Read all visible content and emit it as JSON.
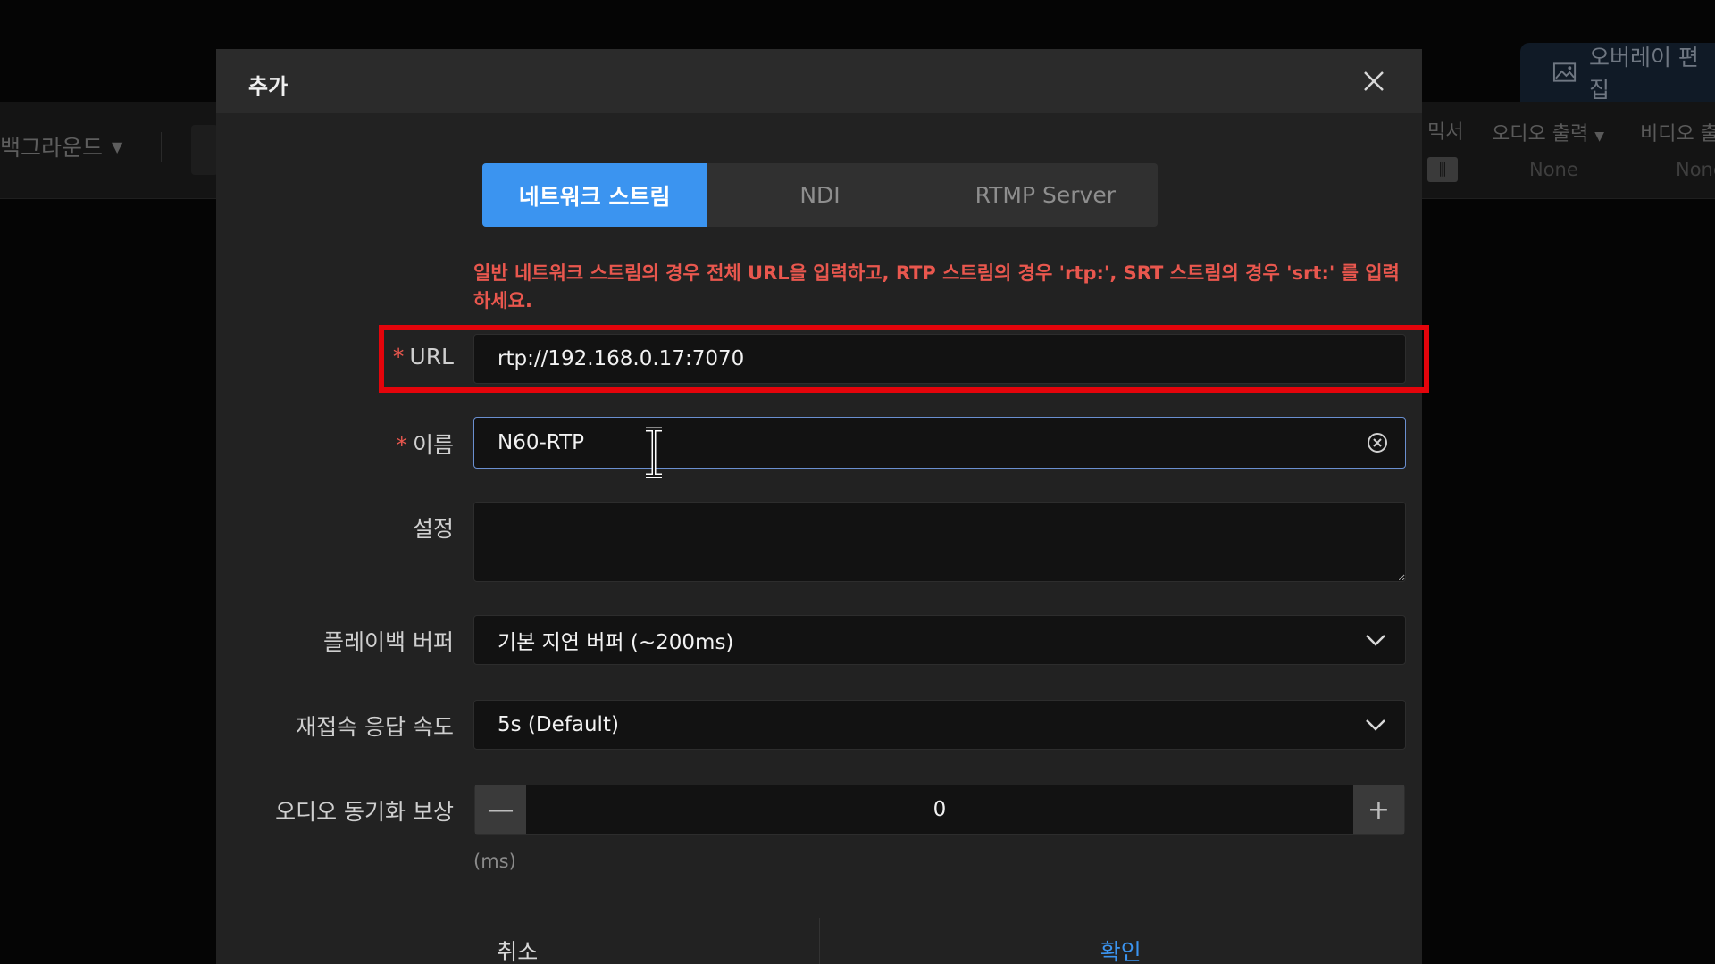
{
  "background": {
    "left_dropdown": "백그라운드",
    "overlay_tab": "오버레이 편집",
    "columns": {
      "mixer": "믹서",
      "audio_output": "오디오 출력",
      "video_output": "비디오 출"
    },
    "audio_output_value": "None",
    "video_output_value": "None"
  },
  "dialog": {
    "title": "추가",
    "tabs": [
      {
        "label": "네트워크 스트림",
        "active": true
      },
      {
        "label": "NDI",
        "active": false
      },
      {
        "label": "RTMP Server",
        "active": false
      }
    ],
    "hint": "일반 네트워크 스트림의 경우 전체 URL을 입력하고, RTP 스트림의 경우 'rtp:', SRT 스트림의 경우 'srt:' 를 입력하세요.",
    "url": {
      "label": "URL",
      "required_mark": "*",
      "value": "rtp://192.168.0.17:7070"
    },
    "name": {
      "label": "이름",
      "required_mark": "*",
      "value": "N60-RTP"
    },
    "settings": {
      "label": "설정",
      "value": ""
    },
    "playback_buffer": {
      "label": "플레이백 버퍼",
      "value": "기본 지연 버퍼 (~200ms)"
    },
    "reconnect_speed": {
      "label": "재접속 응답 속도",
      "value": "5s (Default)"
    },
    "audio_sync": {
      "label": "오디오 동기화 보상",
      "value": "0",
      "unit": "(ms)",
      "minus": "—",
      "plus": "+"
    },
    "cancel_label": "취소",
    "ok_label": "확인"
  },
  "colors": {
    "accent": "#3b94f0",
    "error": "#e9574e",
    "highlight_box": "#e4040b"
  }
}
